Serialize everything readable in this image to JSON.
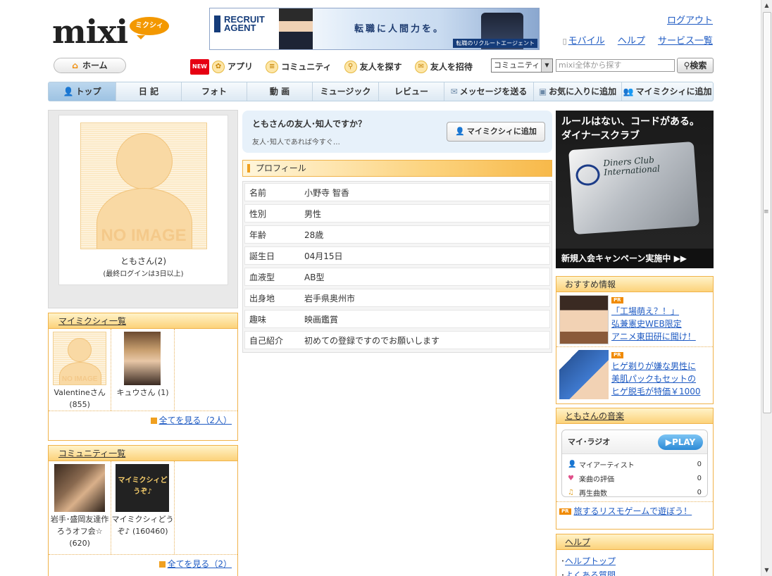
{
  "header": {
    "logo_text": "mixi",
    "logo_bubble": "ミクシィ",
    "banner": {
      "brand": "RECRUIT AGENT",
      "tagline": "転職に人間力を。",
      "footer": "転職のリクルートエージェント"
    },
    "logout": "ログアウト",
    "links": [
      "モバイル",
      "ヘルプ",
      "サービス一覧"
    ]
  },
  "menu": {
    "home": "ホーム",
    "new_badge": "NEW",
    "items": [
      "アプリ",
      "コミュニティ",
      "友人を探す",
      "友人を招待"
    ]
  },
  "search": {
    "select_value": "コミュニティ",
    "placeholder": "mixi全体から探す",
    "button": "検索"
  },
  "nav": {
    "tabs": [
      "トップ",
      "日 記",
      "フォト",
      "動 画",
      "ミュージック",
      "レビュー",
      "メッセージを送る",
      "お気に入りに追加",
      "マイミクシィに追加"
    ]
  },
  "profile_card": {
    "noimage": "NO IMAGE",
    "name": "ともさん(2)",
    "last_login": "(最終ログインは3日以上)"
  },
  "mymixi": {
    "title": "マイミクシィ一覧",
    "friends": [
      {
        "name": "Valentineさん (855)",
        "noimage": "NO IMAGE"
      },
      {
        "name": "キュウさん (1)"
      }
    ],
    "see_all": "全てを見る（2人）"
  },
  "community": {
    "title": "コミュニティ一覧",
    "items": [
      {
        "name": "岩手･盛岡友達作ろうオフ会☆ (620)"
      },
      {
        "name": "マイミクシィどうぞ♪ (160460)",
        "thumb_text": "マイミクシィどうぞ♪"
      }
    ],
    "see_all": "全てを見る（2）"
  },
  "add_friend": {
    "question": "ともさんの友人･知人ですか？",
    "sub": "友人･知人であれば今すぐ…",
    "button": "マイミクシィに追加"
  },
  "profile": {
    "title": "プロフィール",
    "rows": [
      {
        "k": "名前",
        "v": "小野寺 智香"
      },
      {
        "k": "性別",
        "v": "男性"
      },
      {
        "k": "年齢",
        "v": "28歳"
      },
      {
        "k": "誕生日",
        "v": "04月15日"
      },
      {
        "k": "血液型",
        "v": "AB型"
      },
      {
        "k": "出身地",
        "v": "岩手県奥州市"
      },
      {
        "k": "趣味",
        "v": "映画鑑賞"
      },
      {
        "k": "自己紹介",
        "v": "初めての登録ですのでお願いします"
      }
    ]
  },
  "ad_diners": {
    "line1": "ルールはない、コードがある。",
    "line2": "ダイナースクラブ",
    "card_name": "Diners Club International",
    "bottom": "新規入会キャンペーン実施中 ▶▶"
  },
  "recommend": {
    "title": "おすすめ情報",
    "pr": "PR",
    "items": [
      {
        "lines": [
          "「工場萌え？！」",
          "弘兼憲史WEB限定",
          "アニメ東田研に聞け！"
        ]
      },
      {
        "lines": [
          "ヒゲ剃りが嫌な男性に",
          "美肌パックもセットの",
          "ヒゲ脱毛が特価￥1000"
        ]
      }
    ]
  },
  "music": {
    "title": "ともさんの音楽",
    "radio": "マイ･ラジオ",
    "play": "▶PLAY",
    "stats": [
      {
        "label": "マイアーティスト",
        "value": "0"
      },
      {
        "label": "楽曲の評価",
        "value": "0"
      },
      {
        "label": "再生曲数",
        "value": "0"
      }
    ],
    "pr_link": "旅するリスモゲームで遊ぼう！"
  },
  "help": {
    "title": "ヘルプ",
    "items": [
      "ヘルプトップ",
      "よくある質問"
    ]
  }
}
